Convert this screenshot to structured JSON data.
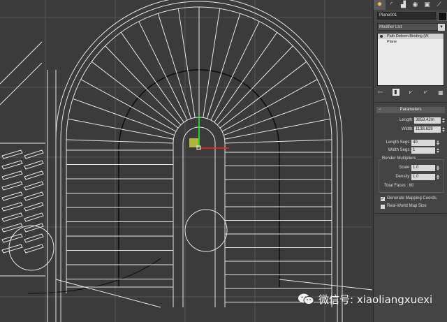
{
  "command_panel": {
    "tabs": [
      {
        "name": "create-tab-icon",
        "glyph": "✹",
        "active": true
      },
      {
        "name": "modify-tab-icon",
        "glyph": "◜",
        "active": false
      },
      {
        "name": "hierarchy-tab-icon",
        "glyph": "▟",
        "active": false
      },
      {
        "name": "motion-tab-icon",
        "glyph": "◉",
        "active": false
      },
      {
        "name": "display-tab-icon",
        "glyph": "▣",
        "active": false
      },
      {
        "name": "utilities-tab-icon",
        "glyph": "⟋",
        "active": false
      }
    ],
    "object_name": "Plane001",
    "object_color": "#111111",
    "modifier_list_label": "Modifier List",
    "modifier_stack": [
      {
        "label": "Path Deform Binding (W",
        "selected": true
      },
      {
        "label": "Plane",
        "selected": false
      }
    ],
    "stack_tools": [
      "⟝",
      "▮",
      "⩗",
      "⩗",
      "▦"
    ],
    "parameters": {
      "title": "Parameters",
      "length_label": "Length:",
      "length_value": "3859.42m",
      "width_label": "Width:",
      "width_value": "1138.629",
      "length_segs_label": "Length Segs:",
      "length_segs_value": "40",
      "width_segs_label": "Width Segs:",
      "width_segs_value": "1",
      "render_multipliers_label": "Render Multipliers",
      "scale_label": "Scale:",
      "scale_value": "1.0",
      "density_label": "Density:",
      "density_value": "1.0",
      "total_faces": "Total Faces : 80",
      "generate_mapping_label": "Generate Mapping Coords.",
      "generate_mapping_checked": true,
      "real_world_label": "Real-World Map Size",
      "real_world_checked": false
    }
  },
  "watermark": {
    "text": "微信号: xiaoliangxuexi"
  },
  "colors": {
    "viewport_bg": "#3b3b3b",
    "wire": "#e6e6e6",
    "grid": "#555555",
    "dark_line": "#0d0d0d",
    "gizmo_x": "#ff2020",
    "gizmo_y": "#20ff20",
    "gizmo_plane": "#c8c840"
  }
}
